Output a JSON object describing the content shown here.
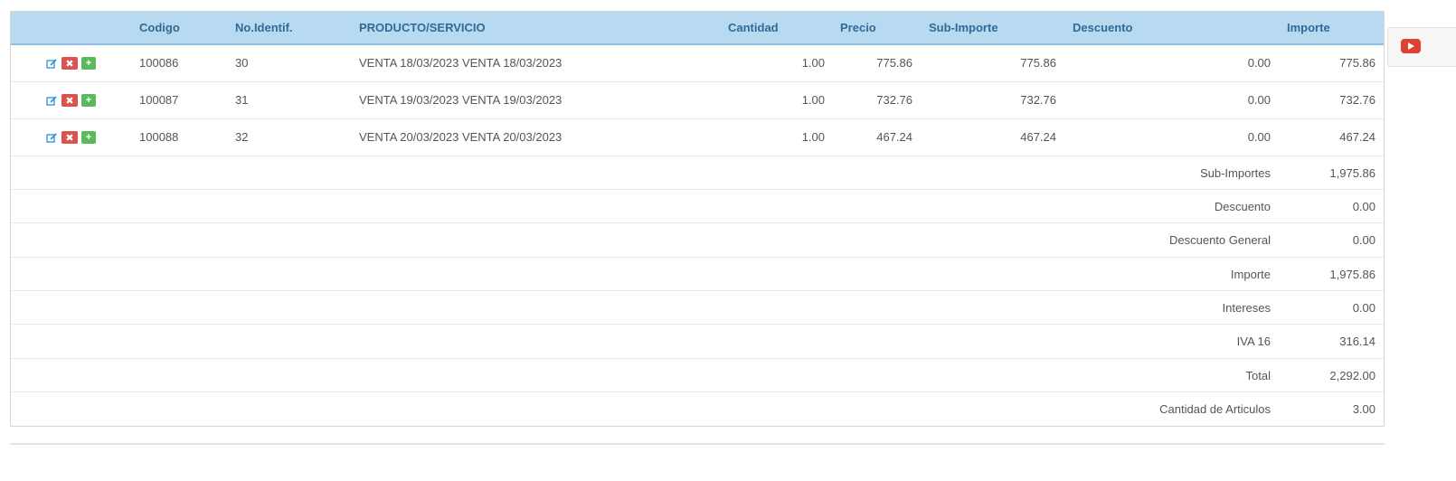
{
  "headers": {
    "codigo": "Codigo",
    "no_identif": "No.Identif.",
    "producto": "PRODUCTO/SERVICIO",
    "cantidad": "Cantidad",
    "precio": "Precio",
    "sub_importe": "Sub-Importe",
    "descuento": "Descuento",
    "importe": "Importe"
  },
  "items": [
    {
      "codigo": "100086",
      "no_identif": "30",
      "producto": "VENTA 18/03/2023 VENTA 18/03/2023",
      "cantidad": "1.00",
      "precio": "775.86",
      "sub_importe": "775.86",
      "descuento": "0.00",
      "importe": "775.86"
    },
    {
      "codigo": "100087",
      "no_identif": "31",
      "producto": "VENTA 19/03/2023 VENTA 19/03/2023",
      "cantidad": "1.00",
      "precio": "732.76",
      "sub_importe": "732.76",
      "descuento": "0.00",
      "importe": "732.76"
    },
    {
      "codigo": "100088",
      "no_identif": "32",
      "producto": "VENTA 20/03/2023 VENTA 20/03/2023",
      "cantidad": "1.00",
      "precio": "467.24",
      "sub_importe": "467.24",
      "descuento": "0.00",
      "importe": "467.24"
    }
  ],
  "totals": [
    {
      "label": "Sub-Importes",
      "value": "1,975.86"
    },
    {
      "label": "Descuento",
      "value": "0.00"
    },
    {
      "label": "Descuento General",
      "value": "0.00"
    },
    {
      "label": "Importe",
      "value": "1,975.86"
    },
    {
      "label": "Intereses",
      "value": "0.00"
    },
    {
      "label": "IVA 16",
      "value": "316.14"
    },
    {
      "label": "Total",
      "value": "2,292.00"
    },
    {
      "label": "Cantidad de Articulos",
      "value": "3.00"
    }
  ],
  "actions": {
    "edit_icon": "edit-icon",
    "delete_glyph": "✖",
    "add_glyph": "+"
  },
  "colors": {
    "header_bg": "#b8daf0",
    "header_text": "#2f6b98",
    "delete": "#d9534f",
    "add": "#5cb85c",
    "youtube": "#e0402f"
  }
}
